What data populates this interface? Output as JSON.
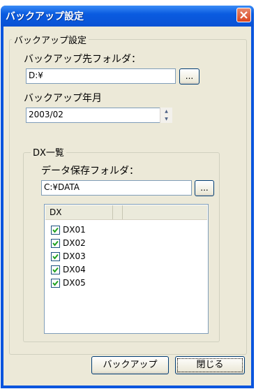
{
  "window": {
    "title": "バックアップ設定"
  },
  "backup_group": {
    "title": "バックアップ設定",
    "folder_label": "バックアップ先フォルダ：",
    "folder_value": "D:¥",
    "browse_label": "...",
    "date_label": "バックアップ年月",
    "date_value": "2003/02"
  },
  "dx_group": {
    "title": "DX一覧",
    "data_folder_label": "データ保存フォルダ：",
    "data_folder_value": "C:¥DATA",
    "browse_label": "...",
    "list_header": "DX",
    "items": [
      {
        "label": "DX01",
        "checked": true
      },
      {
        "label": "DX02",
        "checked": true
      },
      {
        "label": "DX03",
        "checked": true
      },
      {
        "label": "DX04",
        "checked": true
      },
      {
        "label": "DX05",
        "checked": true
      }
    ]
  },
  "buttons": {
    "backup": "バックアップ",
    "close": "閉じる"
  }
}
